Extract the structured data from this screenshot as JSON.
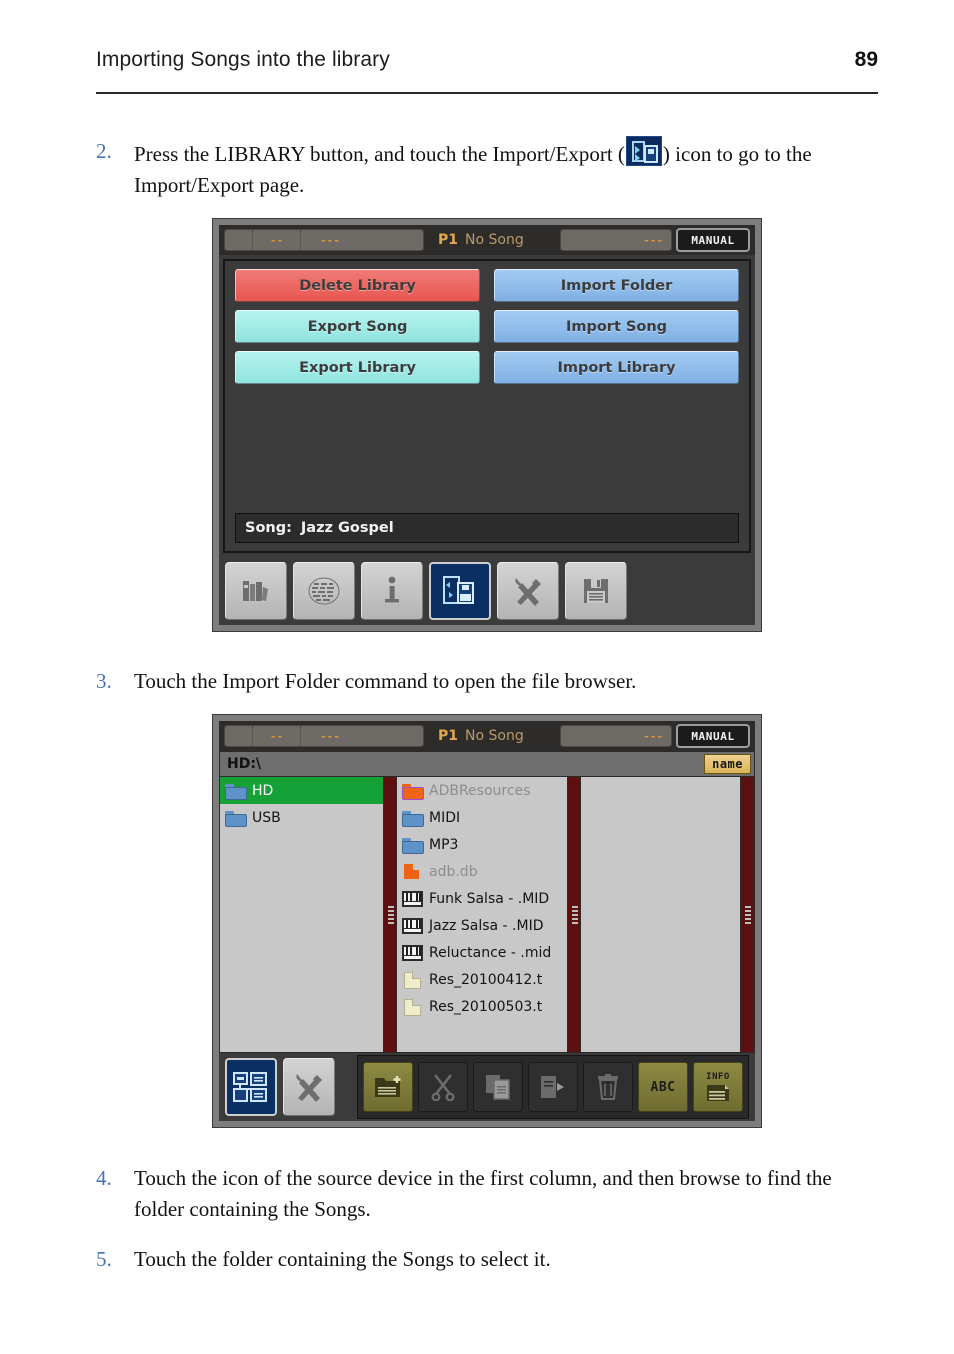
{
  "header": {
    "title": "Importing Songs into the library",
    "page_number": "89"
  },
  "steps": [
    {
      "number": "2.",
      "text_before": "Press the LIBRARY button, and touch the Import/Export (",
      "text_after": ") icon to go to the Import/Export page.",
      "inline_icon": "import-export-icon"
    },
    {
      "number": "3.",
      "text": "Touch the Import Folder command to open the file browser."
    },
    {
      "number": "4.",
      "text": "Touch the icon of the source device in the first column, and then browse to find the folder containing the Songs."
    },
    {
      "number": "5.",
      "text": "Touch the folder containing the Songs to select it."
    }
  ],
  "screenshot1": {
    "statusbar": {
      "cell1": "",
      "cell2": "--",
      "cell3": "---",
      "song_prefix": "P1",
      "song_name": "No Song",
      "right_value": "---",
      "mode_badge": "MANUAL"
    },
    "buttons": [
      {
        "label": "Delete Library",
        "style": "del"
      },
      {
        "label": "Import Folder",
        "style": "imp"
      },
      {
        "label": "Export Song",
        "style": "exp"
      },
      {
        "label": "Import Song",
        "style": "imp"
      },
      {
        "label": "Export Library",
        "style": "exp"
      },
      {
        "label": "Import Library",
        "style": "imp"
      }
    ],
    "song_bar": {
      "label": "Song:",
      "value": "Jazz Gospel"
    },
    "toolbar": [
      {
        "name": "library-books-icon",
        "active": false
      },
      {
        "name": "song-book-icon",
        "active": false
      },
      {
        "name": "info-icon",
        "active": false
      },
      {
        "name": "import-export-icon",
        "active": true
      },
      {
        "name": "tools-icon",
        "active": false
      },
      {
        "name": "save-disk-icon",
        "active": false
      }
    ],
    "colors": {
      "delete_button": "#e8564f",
      "export_button": "#8fe3e0",
      "import_button": "#7fb0e4",
      "active_icon_bg": "#0b2f63",
      "status_amber": "#e3a84c"
    }
  },
  "screenshot2": {
    "statusbar": {
      "cell1": "",
      "cell2": "--",
      "cell3": "---",
      "song_prefix": "P1",
      "song_name": "No Song",
      "right_value": "---",
      "mode_badge": "MANUAL"
    },
    "path": "HD:\\",
    "sort_button": "name",
    "column1": [
      {
        "label": "HD",
        "icon": "folder-blue-icon",
        "selected": true
      },
      {
        "label": "USB",
        "icon": "folder-blue-icon",
        "selected": false
      }
    ],
    "column2": [
      {
        "label": "ADBResources",
        "icon": "folder-orange-icon",
        "dim": true
      },
      {
        "label": "MIDI",
        "icon": "folder-blue-icon",
        "dim": false
      },
      {
        "label": "MP3",
        "icon": "folder-blue-icon",
        "dim": false
      },
      {
        "label": "adb.db",
        "icon": "file-orange-icon",
        "dim": true
      },
      {
        "label": "Funk Salsa - .MID",
        "icon": "midi-file-icon",
        "dim": false
      },
      {
        "label": "Jazz Salsa - .MID",
        "icon": "midi-file-icon",
        "dim": false
      },
      {
        "label": "Reluctance - .mid",
        "icon": "midi-file-icon",
        "dim": false
      },
      {
        "label": "Res_20100412.t",
        "icon": "file-cream-icon",
        "dim": false
      },
      {
        "label": "Res_20100503.t",
        "icon": "file-cream-icon",
        "dim": false
      }
    ],
    "column3": [],
    "toolbar_left": [
      {
        "name": "file-browser-icon",
        "active": true
      },
      {
        "name": "tools-icon",
        "active": false
      }
    ],
    "toolbar_right": [
      {
        "name": "new-folder-icon",
        "label": "",
        "style": "olive"
      },
      {
        "name": "cut-scissors-icon",
        "label": "",
        "style": "dark"
      },
      {
        "name": "copy-icon",
        "label": "",
        "style": "dark"
      },
      {
        "name": "paste-icon",
        "label": "",
        "style": "dark"
      },
      {
        "name": "delete-trash-icon",
        "label": "",
        "style": "dark"
      },
      {
        "name": "abc-rename-icon",
        "label": "ABC",
        "style": "olive"
      },
      {
        "name": "info-table-icon",
        "label": "INFO",
        "style": "olive"
      }
    ],
    "colors": {
      "selected_row": "#15a038",
      "scrollbar": "#5e0f0f",
      "sort_button": "#dbb457",
      "panel_bg": "#c8c8c8"
    }
  }
}
